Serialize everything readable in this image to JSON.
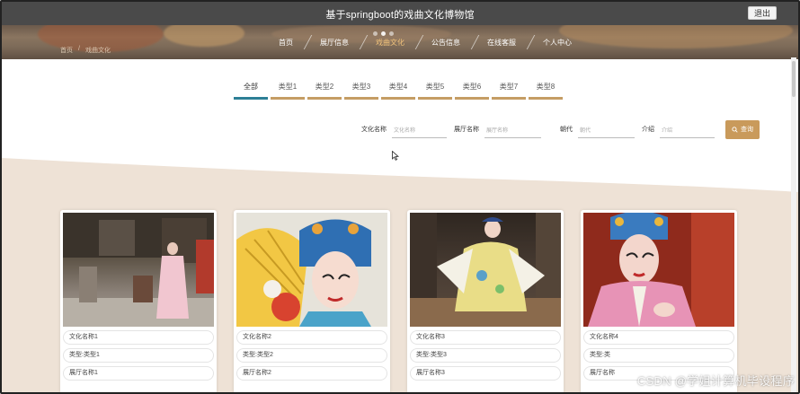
{
  "header": {
    "title": "基于springboot的戏曲文化博物馆",
    "logout_label": "退出"
  },
  "nav": {
    "items": [
      "首页",
      "展厅信息",
      "戏曲文化",
      "公告信息",
      "在线客服",
      "个人中心"
    ],
    "active": "戏曲文化"
  },
  "breadcrumb": {
    "home": "首页",
    "separator": "/",
    "current": "戏曲文化"
  },
  "filter_tabs": [
    "全部",
    "类型1",
    "类型2",
    "类型3",
    "类型4",
    "类型5",
    "类型6",
    "类型7",
    "类型8"
  ],
  "search": {
    "name_label": "文化名称",
    "name_placeholder": "文化名称",
    "hall_label": "展厅名称",
    "hall_placeholder": "展厅名称",
    "era_label": "朝代",
    "era_placeholder": "朝代",
    "intro_label": "介绍",
    "intro_placeholder": "介绍",
    "button_label": "查询"
  },
  "cards": [
    {
      "name": "文化名称1",
      "type": "类型:类型1",
      "hall": "展厅名称1"
    },
    {
      "name": "文化名称2",
      "type": "类型:类型2",
      "hall": "展厅名称2"
    },
    {
      "name": "文化名称3",
      "type": "类型:类型3",
      "hall": "展厅名称3"
    },
    {
      "name": "文化名称4",
      "type": "类型:类",
      "hall": "展厅名称"
    }
  ],
  "watermark": "CSDN @学姐计算机毕设程序",
  "colors": {
    "accent": "#c99a5b",
    "active_tab": "#2d7f96",
    "topbar": "#4a4a4a",
    "content_bg": "#eee2d6"
  }
}
